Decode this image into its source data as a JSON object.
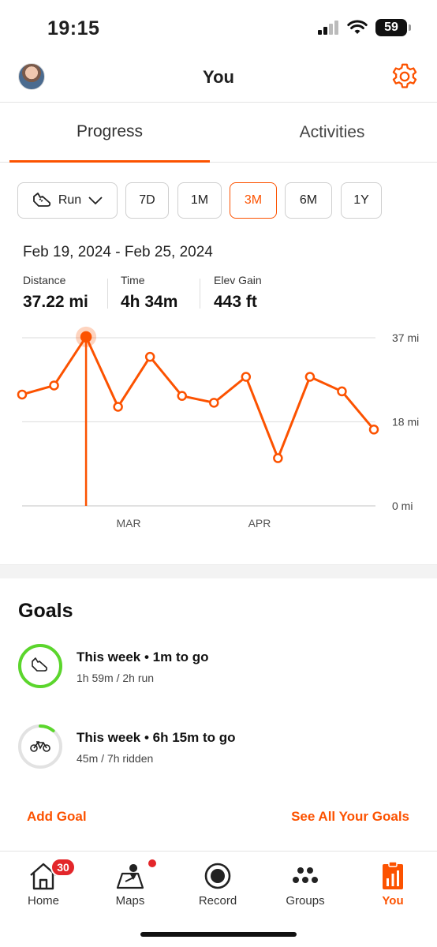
{
  "status_bar": {
    "time": "19:15",
    "battery": "59"
  },
  "header": {
    "title": "You"
  },
  "tabs": [
    {
      "label": "Progress",
      "active": true
    },
    {
      "label": "Activities",
      "active": false
    }
  ],
  "filters": {
    "sport": "Run",
    "ranges": [
      "7D",
      "1M",
      "3M",
      "6M",
      "1Y"
    ],
    "selected_range": "3M"
  },
  "summary": {
    "date_range": "Feb 19, 2024 - Feb 25, 2024",
    "stats": [
      {
        "label": "Distance",
        "value": "37.22 mi"
      },
      {
        "label": "Time",
        "value": "4h 34m"
      },
      {
        "label": "Elev Gain",
        "value": "443 ft"
      }
    ]
  },
  "chart_data": {
    "type": "line",
    "y_unit": "mi",
    "y_ticks": [
      "37 mi",
      "18 mi",
      "0 mi"
    ],
    "x_labels": [
      "MAR",
      "APR"
    ],
    "ylim": [
      0,
      37
    ],
    "values": [
      24.5,
      26.5,
      37.2,
      21.8,
      32.8,
      24.2,
      22.7,
      28.4,
      10.5,
      28.4,
      25.2,
      16.8
    ],
    "selected_index": 2,
    "accent_color": "#fc5200"
  },
  "goals": {
    "title": "Goals",
    "items": [
      {
        "icon": "run-shoe-icon",
        "title": "This week • 1m to go",
        "subtitle": "1h 59m / 2h run",
        "progress": 0.99,
        "ring_color": "#5bd62c"
      },
      {
        "icon": "bike-icon",
        "title": "This week • 6h 15m to go",
        "subtitle": "45m / 7h ridden",
        "progress": 0.11,
        "ring_color": "#5bd62c"
      }
    ],
    "add_goal": "Add Goal",
    "see_all": "See All Your Goals"
  },
  "tabbar": [
    {
      "label": "Home",
      "icon": "home-icon",
      "badge": "30"
    },
    {
      "label": "Maps",
      "icon": "maps-icon",
      "dot": true
    },
    {
      "label": "Record",
      "icon": "record-icon"
    },
    {
      "label": "Groups",
      "icon": "groups-icon"
    },
    {
      "label": "You",
      "icon": "you-icon",
      "active": true
    }
  ]
}
